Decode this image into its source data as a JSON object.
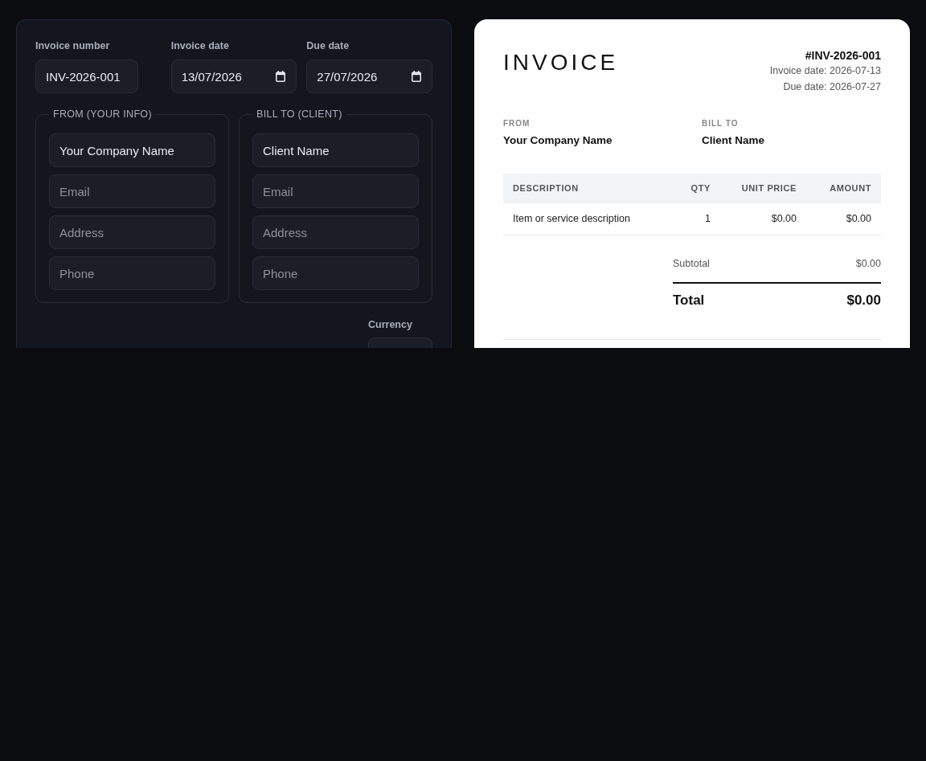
{
  "editor": {
    "fields": [
      {
        "label": "Invoice number",
        "kind": "text",
        "value": "INV-2026-001"
      },
      {
        "label": "Invoice date",
        "kind": "date",
        "value": "13/07/2026"
      },
      {
        "label": "Due date",
        "kind": "date",
        "value": "27/07/2026"
      }
    ],
    "parties": [
      {
        "legend": "FROM (YOUR INFO)",
        "fields": [
          {
            "value": "Your Company Name"
          },
          {
            "placeholder": "Email"
          },
          {
            "placeholder": "Address"
          },
          {
            "placeholder": "Phone"
          }
        ]
      },
      {
        "legend": "BILL TO (CLIENT)",
        "fields": [
          {
            "value": "Client Name"
          },
          {
            "placeholder": "Email"
          },
          {
            "placeholder": "Address"
          },
          {
            "placeholder": "Phone"
          }
        ]
      }
    ],
    "currency": {
      "label": "Currency"
    }
  },
  "preview": {
    "title": "INVOICE",
    "number": "#INV-2026-001",
    "dates": [
      "Invoice date: 2026-07-13",
      "Due date: 2026-07-27"
    ],
    "parties": [
      {
        "label": "FROM",
        "name": "Your Company Name"
      },
      {
        "label": "BILL TO",
        "name": "Client Name"
      }
    ],
    "table": {
      "columns": [
        "DESCRIPTION",
        "QTY",
        "UNIT PRICE",
        "AMOUNT"
      ],
      "rows": [
        [
          "Item or service description",
          "1",
          "$0.00",
          "$0.00"
        ]
      ]
    },
    "totals": [
      {
        "kind": "subtotal",
        "label": "Subtotal",
        "value": "$0.00"
      },
      {
        "kind": "total",
        "label": "Total",
        "value": "$0.00"
      }
    ]
  }
}
